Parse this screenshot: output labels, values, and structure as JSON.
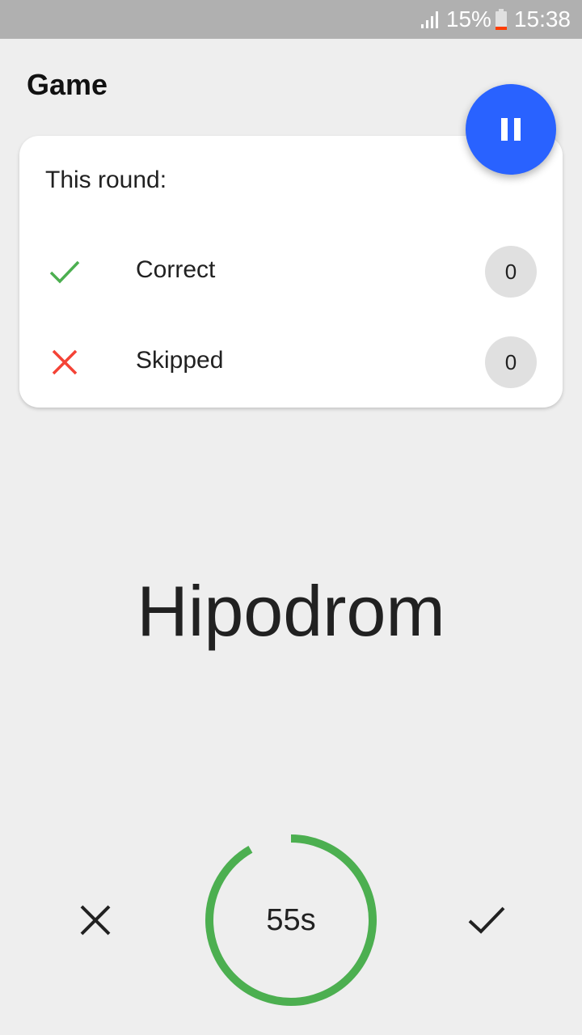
{
  "status_bar": {
    "battery": "15%",
    "time": "15:38"
  },
  "app": {
    "title": "Game"
  },
  "round_card": {
    "header": "This round:",
    "correct": {
      "label": "Correct",
      "count": "0",
      "icon": "check-icon",
      "color": "#4caf50"
    },
    "skipped": {
      "label": "Skipped",
      "count": "0",
      "icon": "close-icon",
      "color": "#f44336"
    }
  },
  "pause_button": {
    "icon": "pause-icon",
    "color": "#2962ff"
  },
  "current_word": "Hipodrom",
  "controls": {
    "skip_icon": "close-icon",
    "correct_icon": "check-icon"
  },
  "timer": {
    "label": "55s",
    "remaining_fraction": 0.917,
    "color": "#4caf50"
  }
}
